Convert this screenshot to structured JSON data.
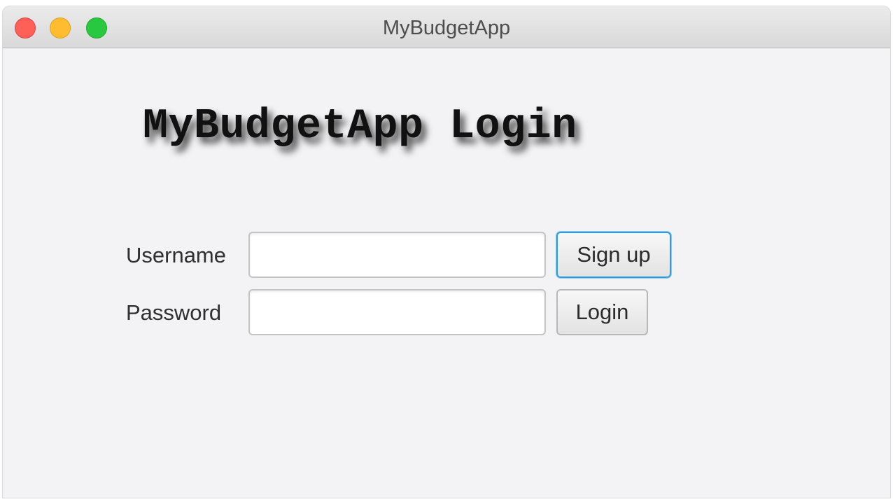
{
  "window": {
    "title": "MyBudgetApp"
  },
  "main": {
    "heading": "MyBudgetApp Login"
  },
  "form": {
    "username_label": "Username",
    "username_value": "",
    "password_label": "Password",
    "password_value": "",
    "signup_label": "Sign up",
    "login_label": "Login"
  },
  "icons": {
    "close": "close-window-icon",
    "minimize": "minimize-window-icon",
    "zoom": "zoom-window-icon"
  },
  "colors": {
    "close": "#fe5f57",
    "minimize": "#febc2e",
    "zoom": "#28c840",
    "focus_ring": "#2e9de0",
    "window_background": "#f3f2f4"
  }
}
